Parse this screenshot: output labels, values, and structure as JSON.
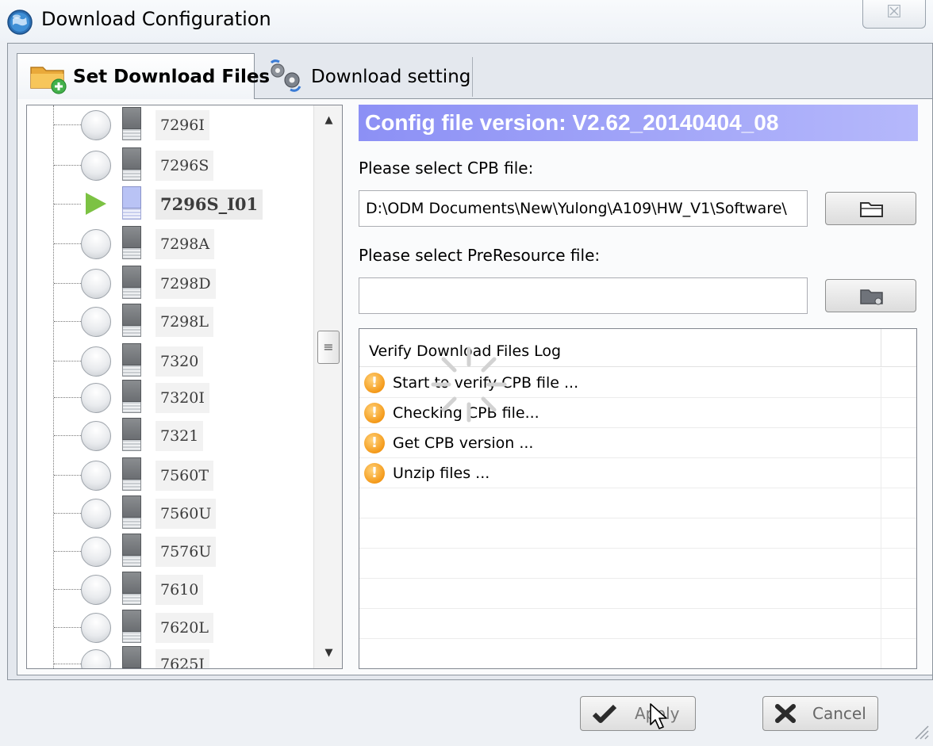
{
  "window": {
    "title": "Download Configuration",
    "close_glyph": "☒"
  },
  "tabs": [
    {
      "label": "Set Download Files",
      "icon": "folder-add-icon",
      "active": true
    },
    {
      "label": "Download setting",
      "icon": "gears-icon",
      "active": false
    }
  ],
  "tree": {
    "items": [
      {
        "label": "7296I",
        "status": "idle",
        "selected": false
      },
      {
        "label": "7296S",
        "status": "idle",
        "selected": false
      },
      {
        "label": "7296S_I01",
        "status": "active",
        "selected": true
      },
      {
        "label": "7298A",
        "status": "idle",
        "selected": false
      },
      {
        "label": "7298D",
        "status": "idle",
        "selected": false
      },
      {
        "label": "7298L",
        "status": "idle",
        "selected": false
      },
      {
        "label": "7320",
        "status": "idle",
        "selected": false
      },
      {
        "label": "7320I",
        "status": "idle",
        "selected": false
      },
      {
        "label": "7321",
        "status": "idle",
        "selected": false
      },
      {
        "label": "7560T",
        "status": "idle",
        "selected": false
      },
      {
        "label": "7560U",
        "status": "idle",
        "selected": false
      },
      {
        "label": "7576U",
        "status": "idle",
        "selected": false
      },
      {
        "label": "7610",
        "status": "idle",
        "selected": false
      },
      {
        "label": "7620L",
        "status": "idle",
        "selected": false
      },
      {
        "label": "7625I",
        "status": "idle",
        "selected": false
      }
    ],
    "scroll_up_glyph": "▲",
    "scroll_down_glyph": "▼",
    "scroll_thumb_glyph": "≡"
  },
  "config": {
    "version_text": "Config file version: V2.62_20140404_08",
    "cpb_label": "Please select CPB file:",
    "cpb_value": "D:\\ODM Documents\\New\\Yulong\\A109\\HW_V1\\Software\\",
    "preresource_label": "Please select PreResource file:",
    "preresource_value": ""
  },
  "log": {
    "header": "Verify Download Files Log",
    "rows": [
      {
        "text": "Start to verify CPB file ...",
        "icon": "warning-icon"
      },
      {
        "text": "Checking CPB file...",
        "icon": "warning-icon"
      },
      {
        "text": "Get CPB version ...",
        "icon": "warning-icon"
      },
      {
        "text": "Unzip files ...",
        "icon": "warning-icon"
      }
    ],
    "warn_glyph": "!"
  },
  "buttons": {
    "apply_label": "Apply",
    "cancel_label": "Cancel"
  },
  "colors": {
    "banner": "#8c90f5",
    "warning": "#f49a1a",
    "play": "#7cc243"
  }
}
